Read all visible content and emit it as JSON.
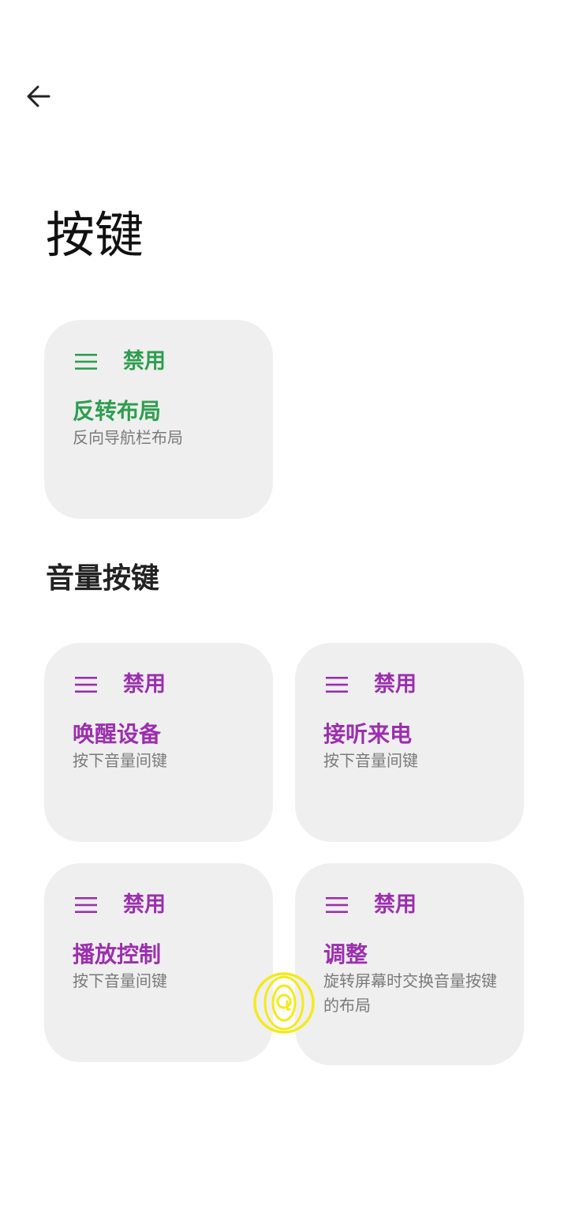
{
  "header": {
    "back_icon": "arrow-left-icon",
    "title": "按键"
  },
  "colors": {
    "green_accent": "#2e9e4f",
    "purple_accent": "#9b2fae",
    "card_bg": "#efefef"
  },
  "cards_top": [
    {
      "state": "禁用",
      "name": "反转布局",
      "desc": "反向导航栏布局",
      "icon": "menu-icon"
    }
  ],
  "volume_section": {
    "title": "音量按键",
    "cards": [
      {
        "state": "禁用",
        "name": "唤醒设备",
        "desc": "按下音量间键",
        "icon": "menu-icon"
      },
      {
        "state": "禁用",
        "name": "接听来电",
        "desc": "按下音量间键",
        "icon": "menu-icon"
      },
      {
        "state": "禁用",
        "name": "播放控制",
        "desc": "按下音量间键",
        "icon": "menu-icon"
      },
      {
        "state": "禁用",
        "name": "调整",
        "desc": "旋转屏幕时交换音量按键的布局",
        "icon": "menu-icon"
      }
    ]
  }
}
